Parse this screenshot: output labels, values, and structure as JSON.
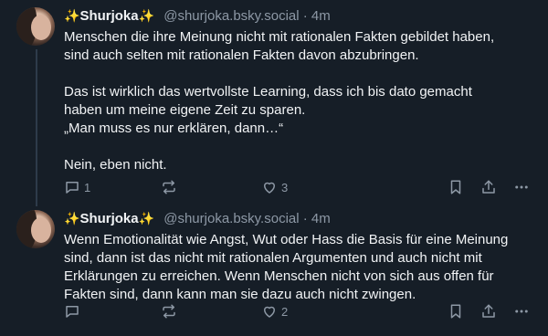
{
  "posts": [
    {
      "author": {
        "display_name": "Shurjoka",
        "sparkle_left": "✨",
        "sparkle_right": "✨",
        "handle": "@shurjoka.bsky.social",
        "separator": "·",
        "time": "4m"
      },
      "text": "Menschen die ihre Meinung nicht mit rationalen Fakten gebildet haben,\nsind auch selten mit rationalen Fakten davon abzubringen.\n\nDas ist wirklich das wertvollste Learning, dass ich bis dato gemacht\nhaben um meine eigene Zeit zu sparen.\n„Man muss es nur erklären, dann…“\n\nNein, eben nicht.",
      "actions": {
        "reply_count": "1",
        "repost_count": "",
        "like_count": "3"
      }
    },
    {
      "author": {
        "display_name": "Shurjoka",
        "sparkle_left": "✨",
        "sparkle_right": "✨",
        "handle": "@shurjoka.bsky.social",
        "separator": "·",
        "time": "4m"
      },
      "text": "Wenn Emotionalität wie Angst, Wut oder Hass die Basis für eine Meinung\nsind, dann ist das nicht mit rationalen Argumenten und auch nicht mit\nErklärungen zu erreichen. Wenn Menschen nicht von sich aus offen für\nFakten sind, dann kann man sie dazu auch nicht zwingen.",
      "actions": {
        "reply_count": "",
        "repost_count": "",
        "like_count": "2"
      }
    }
  ],
  "icons": [
    "reply-icon",
    "repost-icon",
    "like-icon",
    "bookmark-icon",
    "share-icon",
    "more-icon"
  ],
  "colors": {
    "background": "#161e27",
    "text": "#f1f3f5",
    "muted": "#8d98a5",
    "thread_line": "#2e3b4a"
  }
}
